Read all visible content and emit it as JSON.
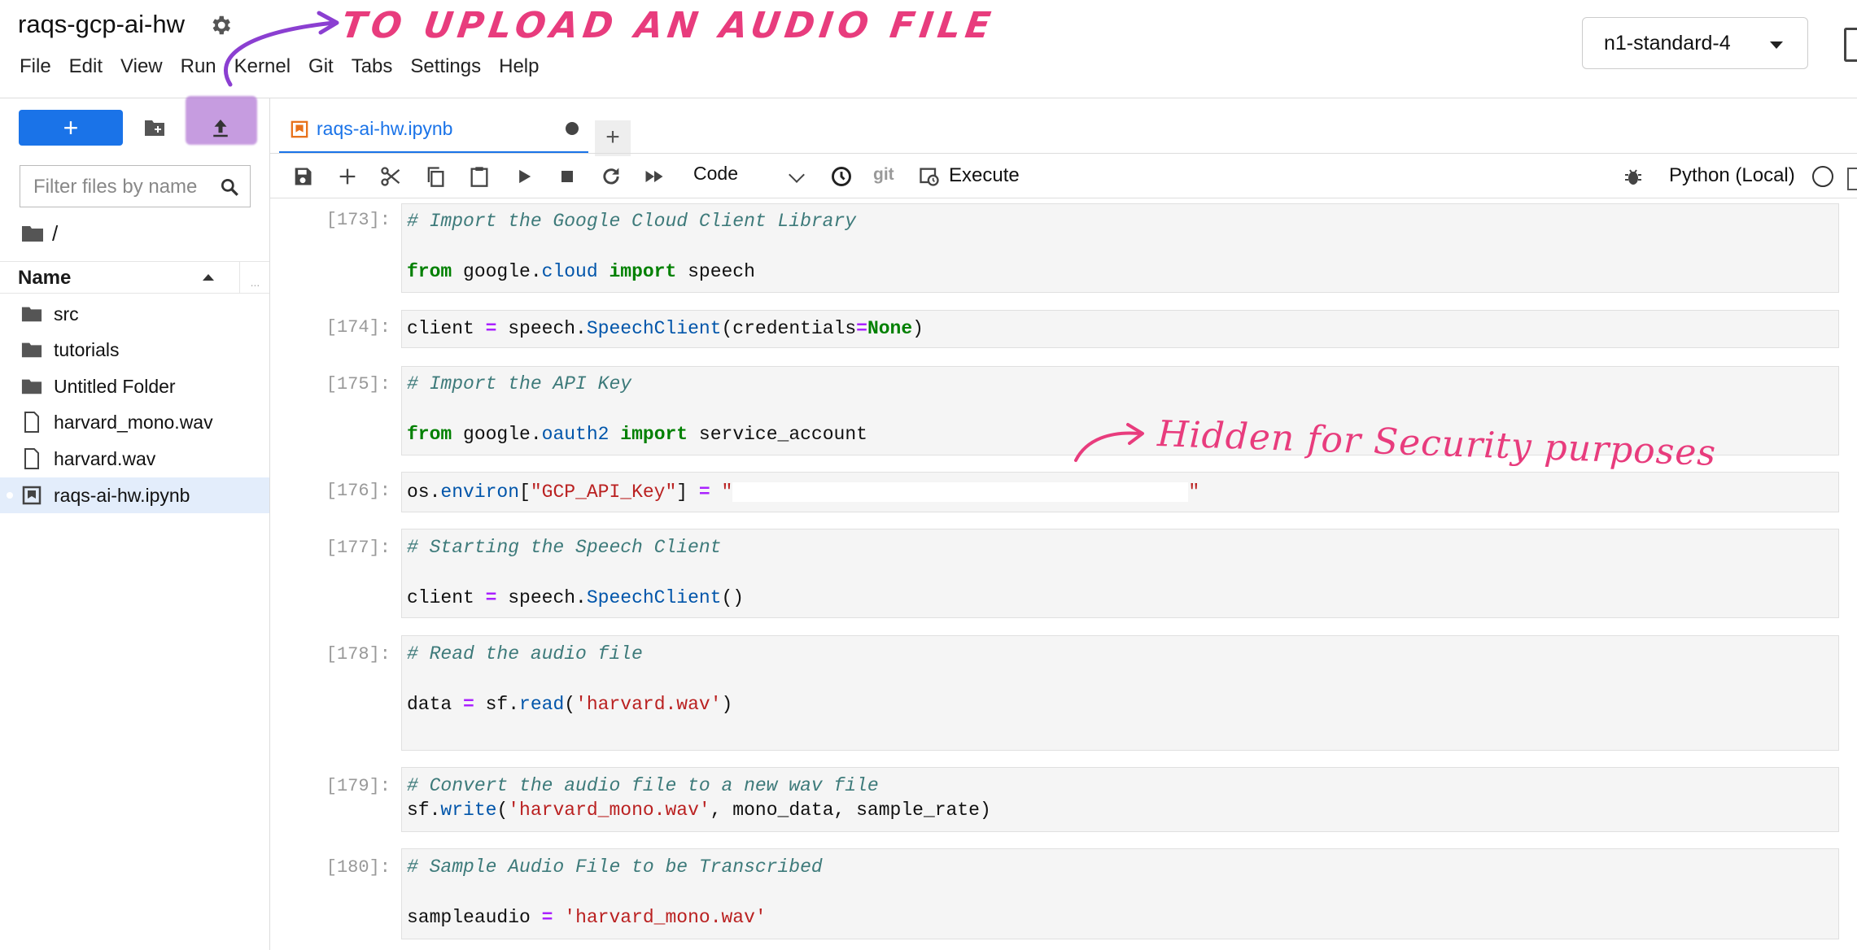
{
  "app": {
    "title": "raqs-gcp-ai-hw"
  },
  "menu": [
    "File",
    "Edit",
    "View",
    "Run",
    "Kernel",
    "Git",
    "Tabs",
    "Settings",
    "Help"
  ],
  "machine": {
    "type": "n1-standard-4"
  },
  "sidebar": {
    "new_button": "+",
    "filter_placeholder": "Filter files by name",
    "breadcrumb": "/",
    "column_name": "Name",
    "column_more": "...",
    "files": [
      {
        "name": "src",
        "icon": "folder-icon"
      },
      {
        "name": "tutorials",
        "icon": "folder-icon"
      },
      {
        "name": "Untitled Folder",
        "icon": "folder-icon"
      },
      {
        "name": "harvard_mono.wav",
        "icon": "file-icon"
      },
      {
        "name": "harvard.wav",
        "icon": "file-icon"
      },
      {
        "name": "raqs-ai-hw.ipynb",
        "icon": "notebook-icon",
        "selected": true
      }
    ]
  },
  "tabs": [
    {
      "label": "raqs-ai-hw.ipynb",
      "modified": true
    }
  ],
  "new_tab": "+",
  "toolbar": {
    "cell_type": "Code",
    "git": "git",
    "execute": "Execute",
    "kernel": "Python (Local)"
  },
  "cells": [
    {
      "prompt": "[173]:",
      "lines": [
        "# Import the Google Cloud Client Library",
        "",
        "from google.cloud import speech"
      ]
    },
    {
      "prompt": "[174]:",
      "lines": [
        "client = speech.SpeechClient(credentials=None)"
      ]
    },
    {
      "prompt": "[175]:",
      "lines": [
        "# Import the API Key",
        "",
        "from google.oauth2 import service_account"
      ]
    },
    {
      "prompt": "[176]:",
      "lines": [
        "os.environ[\"GCP_API_Key\"] = \"\""
      ]
    },
    {
      "prompt": "[177]:",
      "lines": [
        "# Starting the Speech Client",
        "",
        "client = speech.SpeechClient()"
      ]
    },
    {
      "prompt": "[178]:",
      "lines": [
        "# Read the audio file",
        "",
        "data = sf.read('harvard.wav')"
      ]
    },
    {
      "prompt": "[179]:",
      "lines": [
        "# Convert the audio file to a new wav file",
        "sf.write('harvard_mono.wav', mono_data, sample_rate)"
      ]
    },
    {
      "prompt": "[180]:",
      "lines": [
        "# Sample Audio File to be Transcribed",
        "",
        "sampleaudio = 'harvard_mono.wav'"
      ]
    }
  ],
  "annotations": {
    "upload": "TO UPLOAD AN AUDIO FILE",
    "hidden": "Hidden for Security purposes"
  },
  "colors": {
    "accent": "#1a73e8",
    "annotation": "#e83c7d",
    "upload_highlight": "#b47bd6"
  }
}
